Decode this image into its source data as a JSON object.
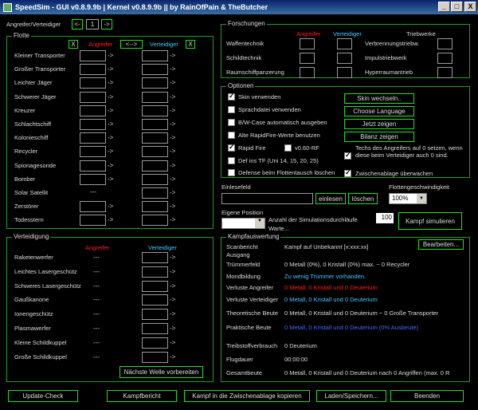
{
  "window": {
    "title": "SpeedSim - GUI v0.8.9.9b | Kernel v0.8.9.9b || by RainOfPain & TheButcher",
    "minimize": "_",
    "maximize": "□",
    "close": "X"
  },
  "attacker_select": {
    "label": "Angreifer/Verteidiger",
    "prev": "<-",
    "value": "1",
    "next": "->"
  },
  "flotte": {
    "title": "Flotte",
    "clear": "X",
    "swap": "<-->",
    "col_att": "Angreifer",
    "col_def": "Verteidiger",
    "ships": [
      "Kleiner Transporter",
      "Großer Transporter",
      "Leichter Jäger",
      "Schwerer Jäger",
      "Kreuzer",
      "Schlachtschiff",
      "Kolonieschiff",
      "Recycler",
      "Spionagesonde",
      "Bomber",
      "Solar Satellit",
      "Zerstörer",
      "Todesstern"
    ],
    "solar_placeholder": "---"
  },
  "verteidigung": {
    "title": "Verteidigung",
    "col_att": "Angreifer",
    "col_def": "Verteidiger",
    "items": [
      "Raketenwerfer",
      "Leichtes Lasergeschütz",
      "Schweres Lasergeschütz",
      "Gaußkanone",
      "Ionengeschütz",
      "Plasmawerfer",
      "Kleine Schildkuppel",
      "Große Schildkuppel"
    ],
    "placeholder": "---",
    "next_wave": "Nächste Welle vorbereiten"
  },
  "forschungen": {
    "title": "Forschungen",
    "col_att": "Angreifer",
    "col_def": "Verteidiger",
    "col_drive": "Triebwerke",
    "techs": [
      "Waffentechnik",
      "Schildtechnik",
      "Raumschiffpanzerung"
    ],
    "drives": [
      "Verbrennungstriebw.",
      "Impulstriebwerk",
      "Hyperraumantrieb"
    ]
  },
  "optionen": {
    "title": "Optionen",
    "skin": "Skin verwenden",
    "sprach": "Sprachdatei verwenden",
    "bw": "B/W-Case automatisch ausgeben",
    "alte": "Alte RapidFire-Werte benutzen",
    "rapid": "Rapid Fire",
    "v060": "v0.60-RF",
    "def_tf": "Def ins TF (Uni 14, 15, 20, 25)",
    "defense_loeschen": "Defense beim Flottentausch löschen",
    "techs_note": "Techs des Angreifers auf 0 setzen, wenn diese beim Verteidiger auch 0 sind.",
    "clipboard": "Zwischenablage überwachen",
    "btn_skin": "Skin wechseln..",
    "btn_lang": "Choose Language",
    "btn_jetzt": "Jetzt zeigen",
    "btn_bilanz": "Bilanz zeigen"
  },
  "einlesefeld": {
    "title": "Einlesefeld",
    "einlesen": "einlesen",
    "loeschen": "löschen"
  },
  "flottengeschw": {
    "title": "Flottengeschwindigkeit",
    "value": "100%"
  },
  "position": {
    "title": "Eigene Position",
    "sim_label": "Anzahl der Simulationsdurchläufe",
    "sim_value": "100",
    "warte": "Warte...",
    "simulate": "Kampf simulieren"
  },
  "kampf": {
    "title": "Kampfauswertung",
    "edit": "Bearbeiten...",
    "rows": [
      {
        "label": "Scanbericht",
        "value": "Kampf auf Unbekannt [x:xxx:xx]",
        "color": "white"
      },
      {
        "label": "Ausgang",
        "value": "",
        "color": "white"
      },
      {
        "label": "Trümmerfeld",
        "value": "0 Metall (0%), 0 Kristall (0%) max. ~ 0 Recycler",
        "color": "white"
      },
      {
        "label": "Mondbildung",
        "value": "Zu wenig Trümmer vorhanden.",
        "color": "cyan"
      },
      {
        "label": "Verluste Angreifer",
        "value": "0 Metall, 0 Kristall und 0 Deuterium",
        "color": "red"
      },
      {
        "label": "Verluste Verteidiger",
        "value": "0 Metall, 0 Kristall und 0 Deuterium",
        "color": "cyan"
      },
      {
        "label": "Theoretische Beute",
        "value": "0 Metall, 0 Kristall und 0 Deuterium ~ 0 Große Transporter",
        "color": "white"
      },
      {
        "label": "Praktische Beute",
        "value": "0 Metall, 0 Kristall und 0 Deuterium (0% Ausbeute)",
        "color": "blue"
      },
      {
        "label": "Treibstoffverbrauch",
        "value": "0 Deuterium",
        "color": "white"
      },
      {
        "label": "Flugdauer",
        "value": "00:00:00",
        "color": "white"
      },
      {
        "label": "Gesamtbeute",
        "value": "0 Metall, 0 Kristall und 0 Deuterium nach 0 Angriffen (max. 0 R",
        "color": "white"
      }
    ]
  },
  "bottom": {
    "update": "Update-Check",
    "kampfbericht": "Kampfbericht",
    "clip": "Kampf in die Zwischenablage kopieren",
    "laden": "Laden/Speichern...",
    "beenden": "Beenden"
  }
}
